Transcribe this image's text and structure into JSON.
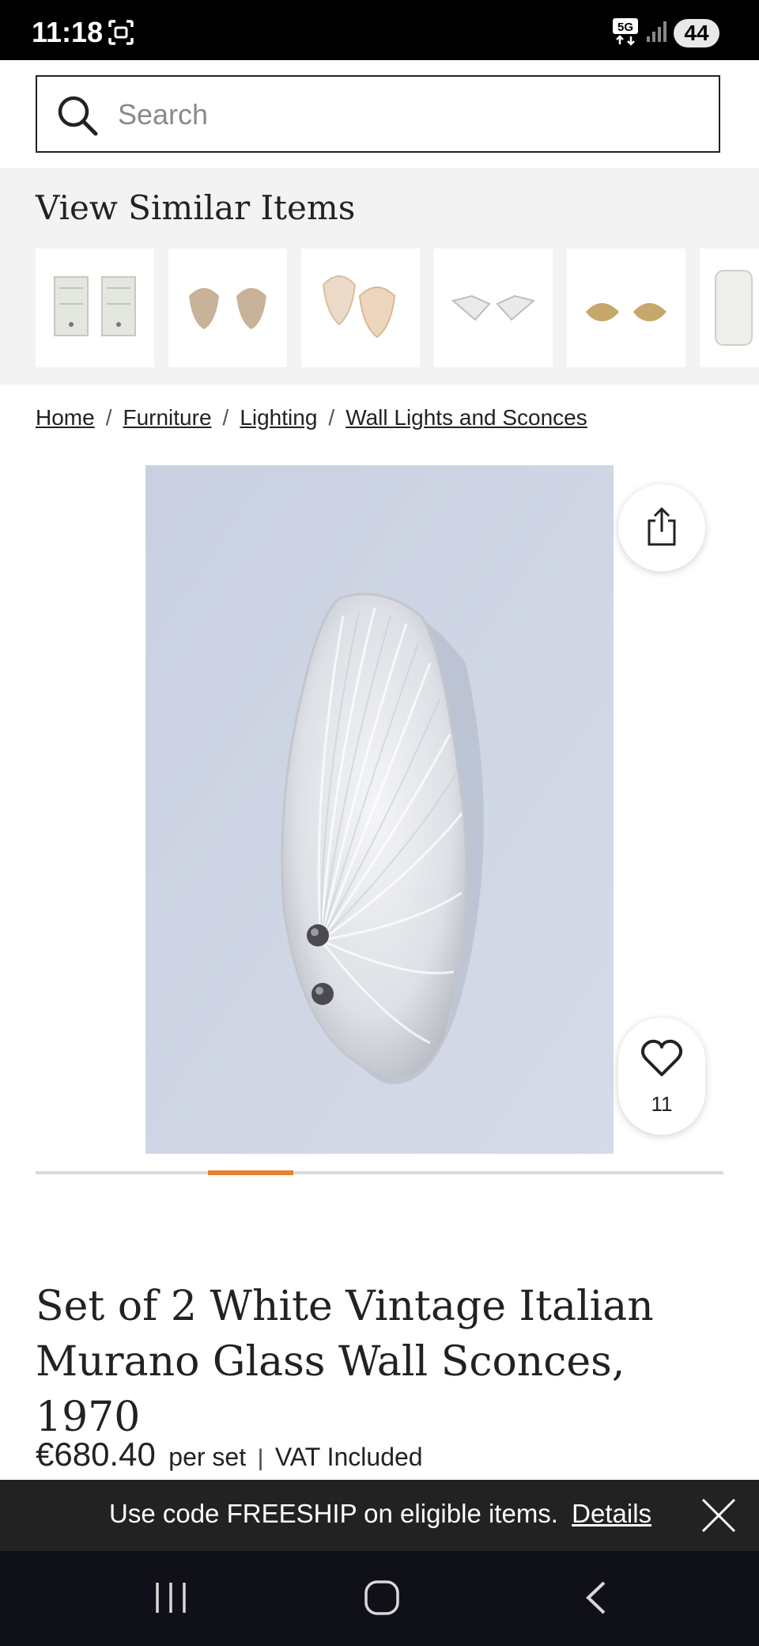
{
  "status_bar": {
    "time": "11:18",
    "battery": "44",
    "network": "5G",
    "icons": [
      "screenshot-icon",
      "5g-icon",
      "signal-icon",
      "battery-icon"
    ]
  },
  "search": {
    "placeholder": "Search",
    "value": ""
  },
  "similar": {
    "title": "View Similar Items",
    "items": [
      {
        "icon": "rectangular-glass-sconces-thumbnail"
      },
      {
        "icon": "shell-sconces-thumbnail"
      },
      {
        "icon": "pink-shell-sconces-thumbnail"
      },
      {
        "icon": "white-leaf-sconces-thumbnail"
      },
      {
        "icon": "gold-shell-sconces-thumbnail"
      },
      {
        "icon": "cylinder-sconce-thumbnail"
      }
    ]
  },
  "breadcrumb": {
    "items": [
      "Home",
      "Furniture",
      "Lighting",
      "Wall Lights and Sconces"
    ],
    "separator": "/"
  },
  "product": {
    "favorites_count": "11",
    "carousel_position": 0.25,
    "title": "Set of 2 White Vintage Italian Murano Glass Wall Sconces, 1970",
    "price": "€680.40",
    "price_unit": "per set",
    "price_separator": "|",
    "vat": "VAT Included"
  },
  "promo": {
    "text": "Use code FREESHIP on eligible items.",
    "link": "Details"
  },
  "colors": {
    "accent": "#e8822b",
    "promo_bg": "#222222",
    "nav_bg": "#101018",
    "similar_bg": "#f3f3f3"
  }
}
